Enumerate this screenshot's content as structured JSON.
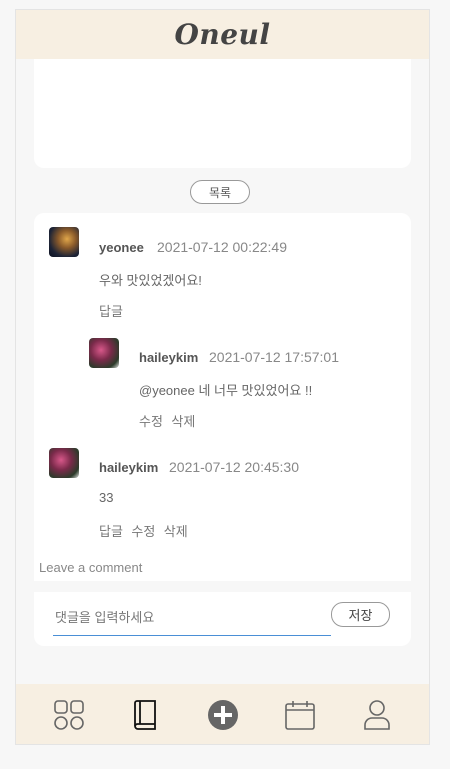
{
  "app": {
    "logo": "Oneul"
  },
  "post": {
    "list_button_label": "목록"
  },
  "comments": [
    {
      "author": "yeonee",
      "date": "2021-07-12 00:22:49",
      "text": "우와 맛있었겠어요!",
      "actions": [
        "답글"
      ]
    },
    {
      "author": "haileykim",
      "date": "2021-07-12 17:57:01",
      "text": "@yeonee 네 너무 맛있었어요 !!",
      "actions": [
        "수정",
        "삭제"
      ],
      "reply": true
    },
    {
      "author": "haileykim",
      "date": "2021-07-12 20:45:30",
      "text": "33",
      "actions": [
        "답글",
        "수정",
        "삭제"
      ]
    }
  ],
  "comment_form": {
    "label": "Leave a comment",
    "placeholder": "댓글을 입력하세요",
    "save_label": "저장"
  },
  "bottom_nav": {
    "items": [
      {
        "icon": "grid-icon"
      },
      {
        "icon": "book-icon",
        "active": true
      },
      {
        "icon": "plus-circle-icon"
      },
      {
        "icon": "calendar-icon"
      },
      {
        "icon": "user-icon"
      }
    ]
  }
}
